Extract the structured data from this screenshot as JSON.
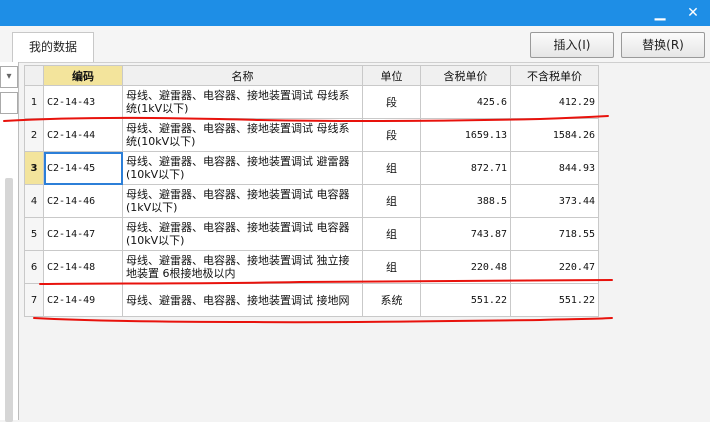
{
  "titlebar": {
    "minimize_glyph": "▁",
    "close_glyph": "✕"
  },
  "toolbar": {
    "tab_label": "我的数据",
    "insert_label": "插入(I)",
    "replace_label": "替换(R)"
  },
  "table": {
    "headers": {
      "index": "",
      "code": "编码",
      "name": "名称",
      "unit": "单位",
      "price_tax": "含税单价",
      "price_notax": "不含税单价"
    },
    "rows": [
      {
        "idx": "1",
        "code": "C2-14-43",
        "name": "母线、避雷器、电容器、接地装置调试 母线系统(1kV以下)",
        "unit": "段",
        "price_tax": "425.6",
        "price_notax": "412.29"
      },
      {
        "idx": "2",
        "code": "C2-14-44",
        "name": "母线、避雷器、电容器、接地装置调试 母线系统(10kV以下)",
        "unit": "段",
        "price_tax": "1659.13",
        "price_notax": "1584.26"
      },
      {
        "idx": "3",
        "code": "C2-14-45",
        "name": "母线、避雷器、电容器、接地装置调试 避雷器(10kV以下)",
        "unit": "组",
        "price_tax": "872.71",
        "price_notax": "844.93"
      },
      {
        "idx": "4",
        "code": "C2-14-46",
        "name": "母线、避雷器、电容器、接地装置调试 电容器(1kV以下)",
        "unit": "组",
        "price_tax": "388.5",
        "price_notax": "373.44"
      },
      {
        "idx": "5",
        "code": "C2-14-47",
        "name": "母线、避雷器、电容器、接地装置调试 电容器(10kV以下)",
        "unit": "组",
        "price_tax": "743.87",
        "price_notax": "718.55"
      },
      {
        "idx": "6",
        "code": "C2-14-48",
        "name": "母线、避雷器、电容器、接地装置调试 独立接地装置 6根接地极以内",
        "unit": "组",
        "price_tax": "220.48",
        "price_notax": "220.47"
      },
      {
        "idx": "7",
        "code": "C2-14-49",
        "name": "母线、避雷器、电容器、接地装置调试 接地网",
        "unit": "系统",
        "price_tax": "551.22",
        "price_notax": "551.22"
      }
    ]
  },
  "colors": {
    "titlebar": "#1e8ee6",
    "header_highlight": "#f3e49c",
    "annotation": "#e8120c"
  }
}
